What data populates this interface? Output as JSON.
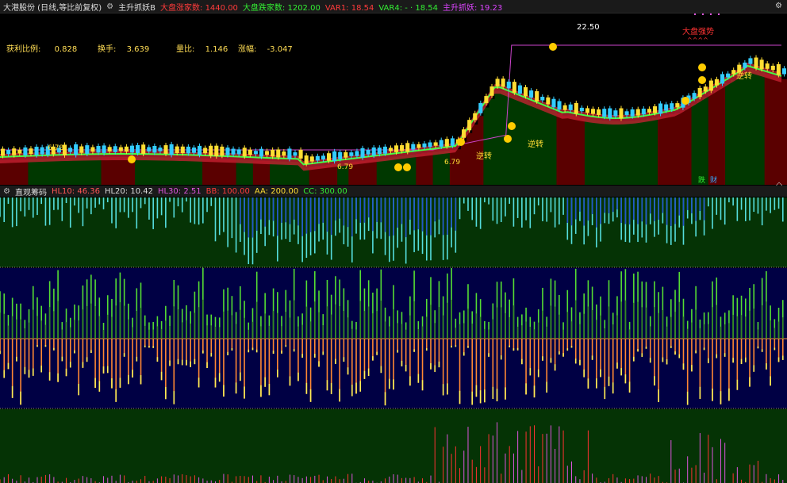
{
  "header": {
    "stock_title": "大港股份 (日线,等比前复权)",
    "indicator_name": "主升抓妖B",
    "items": [
      {
        "label": "大盘涨家数:",
        "value": "1440.00",
        "color": "#ff3b3b"
      },
      {
        "label": "大盘跌家数:",
        "value": "1202.00",
        "color": "#33ee33"
      },
      {
        "label": "VAR1:",
        "value": "18.54",
        "color": "#ff3b3b"
      },
      {
        "label": "VAR4:",
        "value": "- · 18.54",
        "color": "#33ee33"
      },
      {
        "label": "主升抓妖:",
        "value": "19.23",
        "color": "#dd44ff"
      }
    ],
    "corner_icon_top": "gear-icon",
    "corner_icon_mid": "diamond-icon"
  },
  "stats": [
    {
      "label": "获利比例:",
      "value": "0.828"
    },
    {
      "label": "换手:",
      "value": "3.639"
    },
    {
      "label": "量比:",
      "value": "1.146"
    },
    {
      "label": "涨幅:",
      "value": "-3.047"
    }
  ],
  "chart_labels": {
    "high_price": "22.50",
    "market_text": "大盘强势",
    "market_marks": "^^^^",
    "turn_label": "逆转",
    "bottom_tag_1": "跌",
    "bottom_tag_2": "财",
    "left_labels": [
      "6.78",
      "6.79",
      "6.79"
    ]
  },
  "panel2": {
    "title": "直观筹码",
    "items": [
      {
        "label": "HL10:",
        "value": "46.36",
        "color": "#ff5555"
      },
      {
        "label": "HL20:",
        "value": "10.42",
        "color": "#dddddd"
      },
      {
        "label": "HL30:",
        "value": "2.51",
        "color": "#dd55dd"
      },
      {
        "label": "BB:",
        "value": "100.00",
        "color": "#ff3b3b"
      },
      {
        "label": "AA:",
        "value": "200.00",
        "color": "#ffdd33"
      },
      {
        "label": "CC:",
        "value": "300.00",
        "color": "#33ee33"
      }
    ]
  },
  "colors": {
    "background": "#000000",
    "up_red": "#ff2222",
    "down_green": "#00dd00",
    "bar_bg_red": "#5a0000",
    "bar_bg_green": "#003800",
    "band_red": "#cc2233",
    "ma_green": "#44ff44",
    "ma_magenta": "#cc44cc",
    "cyan_bar": "#55dddd",
    "blue_bar": "#2255cc",
    "green_bar": "#55dd33",
    "orange_bar": "#ff8833",
    "yellow_bar": "#ffee55",
    "navy_bg": "#000044"
  }
}
